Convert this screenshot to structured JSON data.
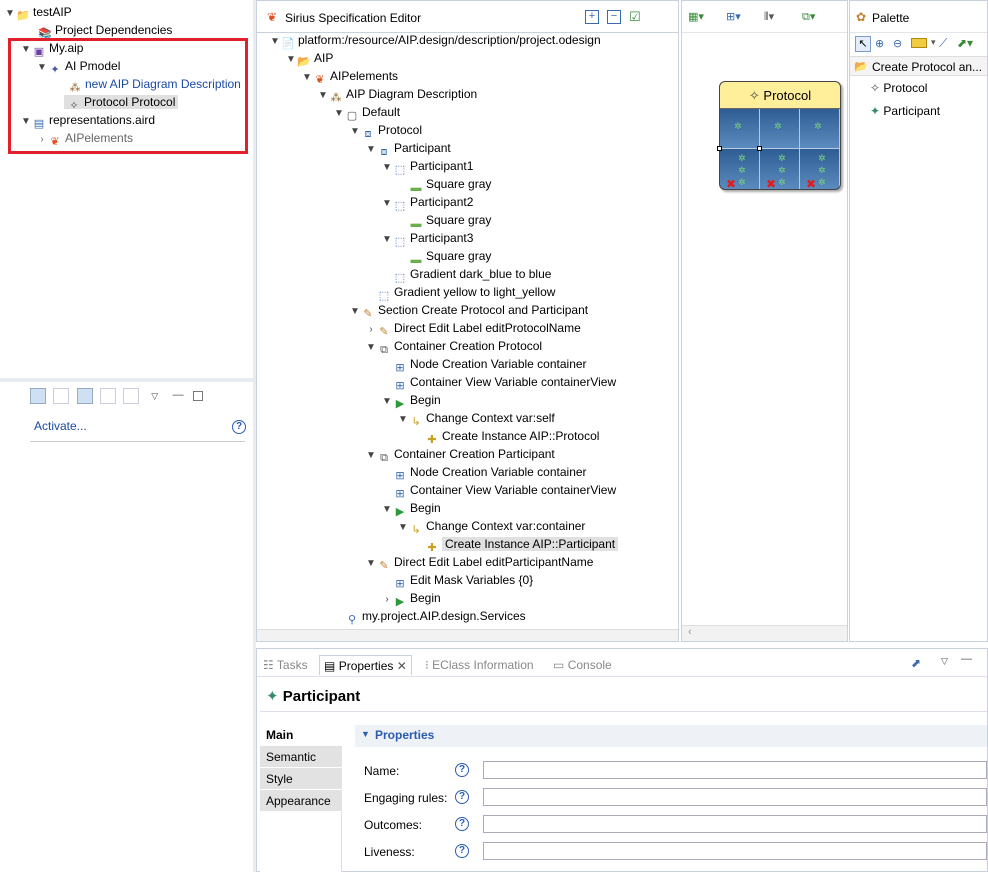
{
  "explorer": {
    "rows": [
      {
        "label": "testAIP"
      },
      {
        "label": "Project Dependencies"
      },
      {
        "label": "My.aip"
      },
      {
        "label": "AI Pmodel"
      },
      {
        "label": "new AIP Diagram Description"
      },
      {
        "label": "Protocol Protocol"
      },
      {
        "label": "representations.aird"
      },
      {
        "label": "AIPelements"
      }
    ],
    "activate_link": "Activate..."
  },
  "editor": {
    "title": "Sirius Specification Editor",
    "tree": [
      {
        "label": "platform:/resource/AIP.design/description/project.odesign"
      },
      {
        "label": "AIP"
      },
      {
        "label": "AIPelements"
      },
      {
        "label": "AIP Diagram Description"
      },
      {
        "label": "Default"
      },
      {
        "label": "Protocol"
      },
      {
        "label": "Participant"
      },
      {
        "label": "Participant1"
      },
      {
        "label": "Square gray"
      },
      {
        "label": "Participant2"
      },
      {
        "label": "Square gray"
      },
      {
        "label": "Participant3"
      },
      {
        "label": "Square gray"
      },
      {
        "label": "Gradient dark_blue to blue"
      },
      {
        "label": "Gradient yellow to light_yellow"
      },
      {
        "label": "Section Create Protocol and Participant"
      },
      {
        "label": "Direct Edit Label editProtocolName"
      },
      {
        "label": "Container Creation Protocol"
      },
      {
        "label": "Node Creation Variable container"
      },
      {
        "label": "Container View Variable containerView"
      },
      {
        "label": "Begin"
      },
      {
        "label": "Change Context var:self"
      },
      {
        "label": "Create Instance AIP::Protocol"
      },
      {
        "label": "Container Creation Participant"
      },
      {
        "label": "Node Creation Variable container"
      },
      {
        "label": "Container View Variable containerView"
      },
      {
        "label": "Begin"
      },
      {
        "label": "Change Context var:container"
      },
      {
        "label": "Create Instance AIP::Participant"
      },
      {
        "label": "Direct Edit Label editParticipantName"
      },
      {
        "label": "Edit Mask Variables {0}"
      },
      {
        "label": "Begin"
      },
      {
        "label": "my.project.AIP.design.Services"
      }
    ]
  },
  "diagram": {
    "node_title": "Protocol"
  },
  "palette": {
    "title": "Palette",
    "section": "Create Protocol an...",
    "items": [
      "Protocol",
      "Participant"
    ]
  },
  "bottom": {
    "tabs": [
      "Tasks",
      "Properties",
      "EClass Information",
      "Console"
    ],
    "selection_title": "Participant",
    "side_tabs": [
      "Main",
      "Semantic",
      "Style",
      "Appearance"
    ],
    "section_title": "Properties",
    "fields": [
      {
        "label": "Name:",
        "value": ""
      },
      {
        "label": "Engaging rules:",
        "value": ""
      },
      {
        "label": "Outcomes:",
        "value": ""
      },
      {
        "label": "Liveness:",
        "value": ""
      }
    ]
  },
  "colors": {
    "highlight_border": "#e0202a",
    "node_header": "#ffef9a",
    "node_body": "#2c5b8c",
    "link_blue": "#1a4ba3"
  }
}
